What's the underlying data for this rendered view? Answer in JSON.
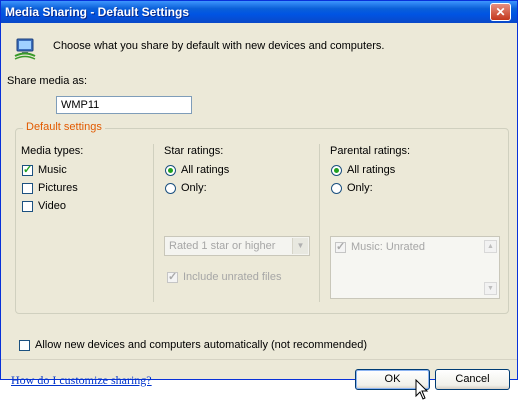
{
  "window": {
    "title": "Media Sharing - Default Settings",
    "close_glyph": "✕"
  },
  "intro": "Choose what you share by default with new devices and computers.",
  "share_media_as": {
    "label": "Share media as:",
    "value": "WMP11"
  },
  "default_settings": {
    "legend": "Default settings",
    "media_types": {
      "label": "Media types:",
      "items": [
        {
          "label": "Music",
          "checked": true
        },
        {
          "label": "Pictures",
          "checked": false
        },
        {
          "label": "Video",
          "checked": false
        }
      ]
    },
    "star_ratings": {
      "label": "Star ratings:",
      "all_label": "All ratings",
      "only_label": "Only:",
      "selected": "all",
      "dropdown_value": "Rated 1 star or higher",
      "include_unrated_label": "Include unrated files",
      "include_unrated_checked": true
    },
    "parental_ratings": {
      "label": "Parental ratings:",
      "all_label": "All ratings",
      "only_label": "Only:",
      "selected": "all",
      "list_items": [
        {
          "label": "Music: Unrated",
          "checked": true
        }
      ]
    }
  },
  "allow_new_devices": {
    "label": "Allow new devices and computers automatically (not recommended)",
    "checked": false
  },
  "help_link": "How do I customize sharing?",
  "buttons": {
    "ok": "OK",
    "cancel": "Cancel"
  },
  "colors": {
    "legend_accent": "#e25a00",
    "titlebar": "#0054e3",
    "link": "#0033cc"
  }
}
